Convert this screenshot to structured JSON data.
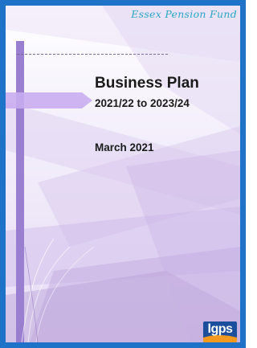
{
  "header": {
    "brand": "Essex Pension Fund"
  },
  "cover": {
    "title": "Business Plan",
    "period": "2021/22 to 2023/24",
    "date": "March 2021"
  },
  "logo": {
    "text": "lgps"
  }
}
